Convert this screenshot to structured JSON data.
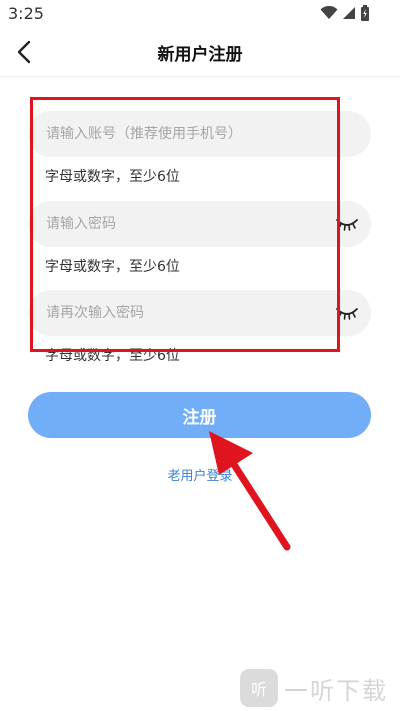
{
  "status_bar": {
    "time": "3:25",
    "icons": [
      "wifi-icon",
      "signal-icon",
      "battery-icon"
    ]
  },
  "header": {
    "title": "新用户注册",
    "back_icon": "chevron-left-icon"
  },
  "form": {
    "account": {
      "value": "",
      "placeholder": "请输入账号（推荐使用手机号）",
      "hint": "字母或数字，至少6位"
    },
    "password": {
      "value": "",
      "placeholder": "请输入密码",
      "hint": "字母或数字，至少6位",
      "toggle_icon": "eye-closed-icon"
    },
    "confirm_password": {
      "value": "",
      "placeholder": "请再次输入密码",
      "hint": "字母或数字，至少6位",
      "toggle_icon": "eye-closed-icon"
    },
    "submit_label": "注册",
    "login_link": "老用户登录"
  },
  "watermark": {
    "logo_text": "听",
    "text": "一听下载"
  },
  "colors": {
    "accent": "#72aef7",
    "link": "#3a7fd6",
    "annotation": "#e0141e",
    "field_bg": "#f2f2f2"
  }
}
